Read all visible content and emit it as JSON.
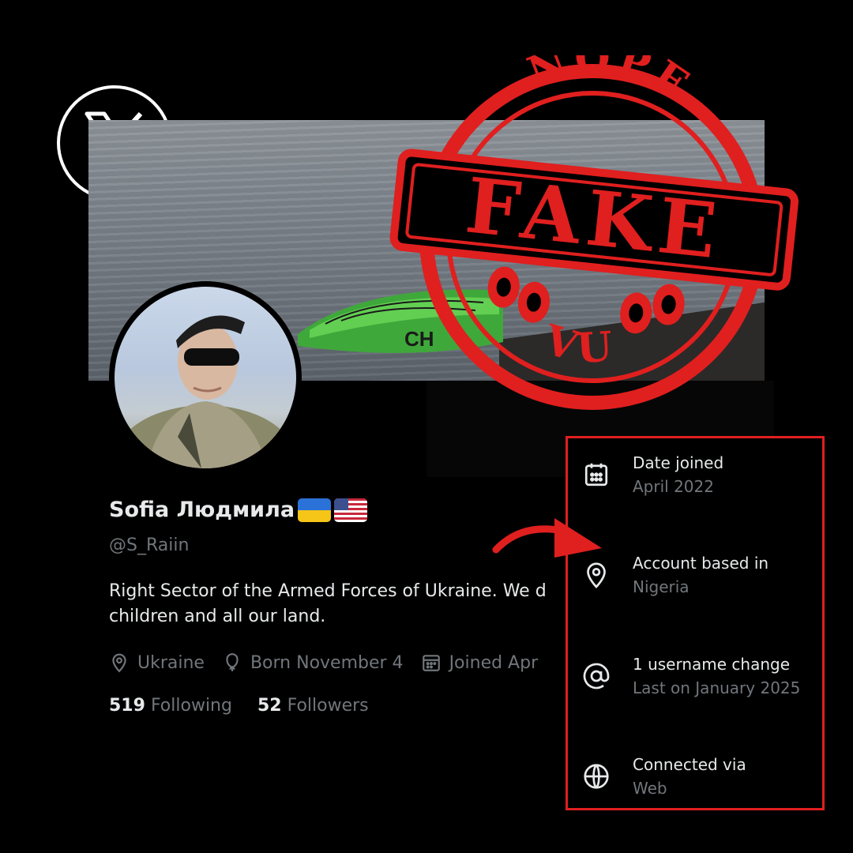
{
  "branding": {
    "logo_icon": "x-logo-icon"
  },
  "profile": {
    "display_name": "Sofia Людмила",
    "flags": [
      "ukraine-flag",
      "usa-flag"
    ],
    "handle": "@S_Raiin",
    "bio_line1": "Right Sector of the Armed Forces of Ukraine. We d",
    "bio_line2": "children and all our land.",
    "location": "Ukraine",
    "birthday": "Born November 4",
    "joined": "Joined Apr",
    "following_count": "519",
    "following_label": "Following",
    "followers_count": "52",
    "followers_label": "Followers"
  },
  "about": {
    "items": [
      {
        "icon": "calendar-icon",
        "label": "Date joined",
        "value": "April 2022"
      },
      {
        "icon": "location-pin-icon",
        "label": "Account based in",
        "value": "Nigeria"
      },
      {
        "icon": "at-sign-icon",
        "label": "1 username change",
        "value": "Last on January 2025"
      },
      {
        "icon": "globe-icon",
        "label": "Connected via",
        "value": "Web"
      }
    ]
  },
  "stamp": {
    "top_text": "NOPE",
    "main_text": "FAKE",
    "bottom_text": "VU",
    "color": "#e01f1f"
  },
  "colors": {
    "background": "#000000",
    "primary_text": "#e7e9ea",
    "secondary_text": "#71767b",
    "highlight_border": "#e01f1f"
  }
}
